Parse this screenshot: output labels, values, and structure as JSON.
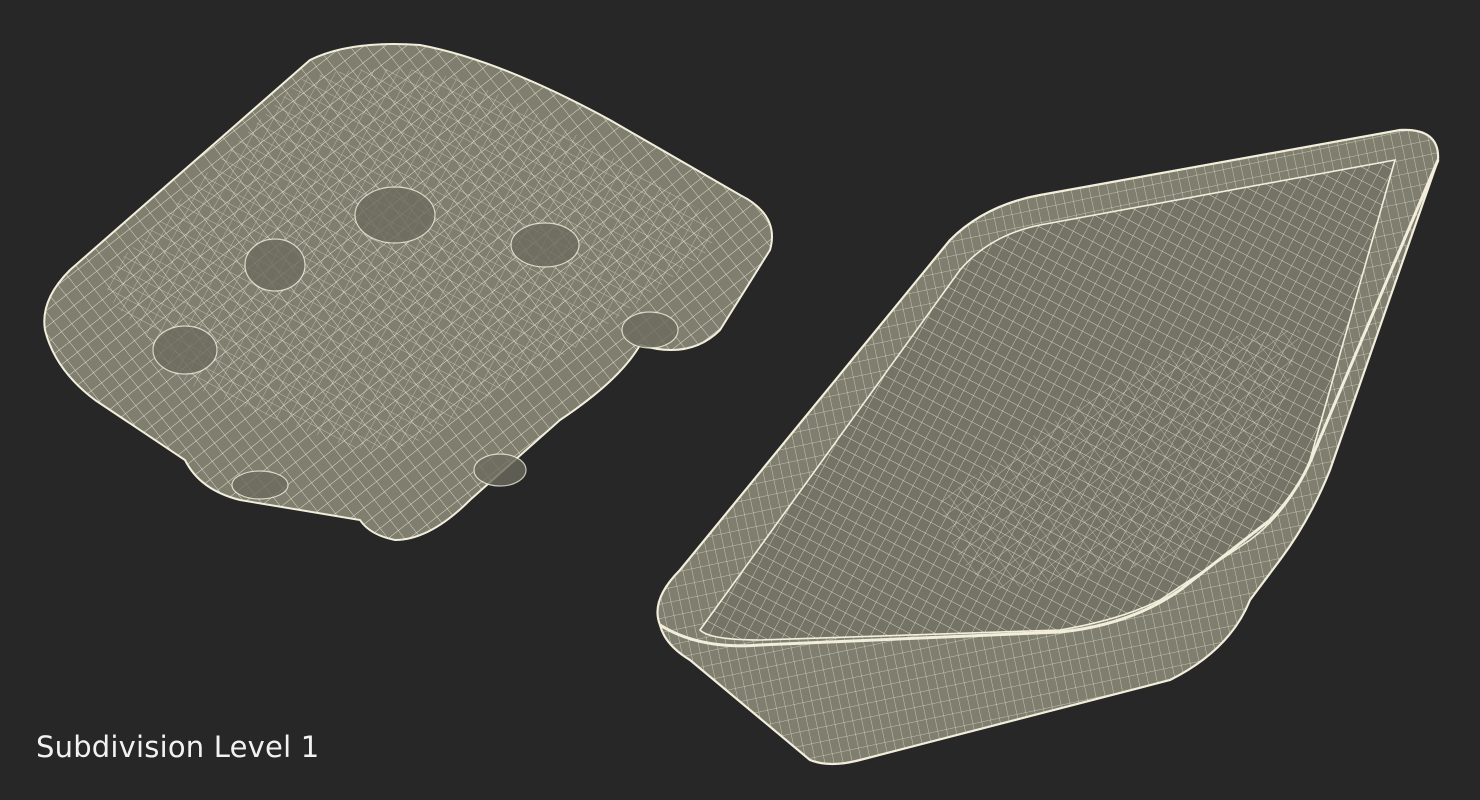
{
  "caption": "Subdivision Level 1",
  "colors": {
    "background": "#272727",
    "surface": "#7f7e6f",
    "surface_dark": "#5f5e52",
    "wire": "#f2eedb",
    "caption_text": "#f2f2f2"
  },
  "objects": [
    {
      "name": "tray-wireframe-left",
      "view": "three-quarter from below"
    },
    {
      "name": "tray-wireframe-right",
      "view": "three-quarter from above"
    }
  ]
}
